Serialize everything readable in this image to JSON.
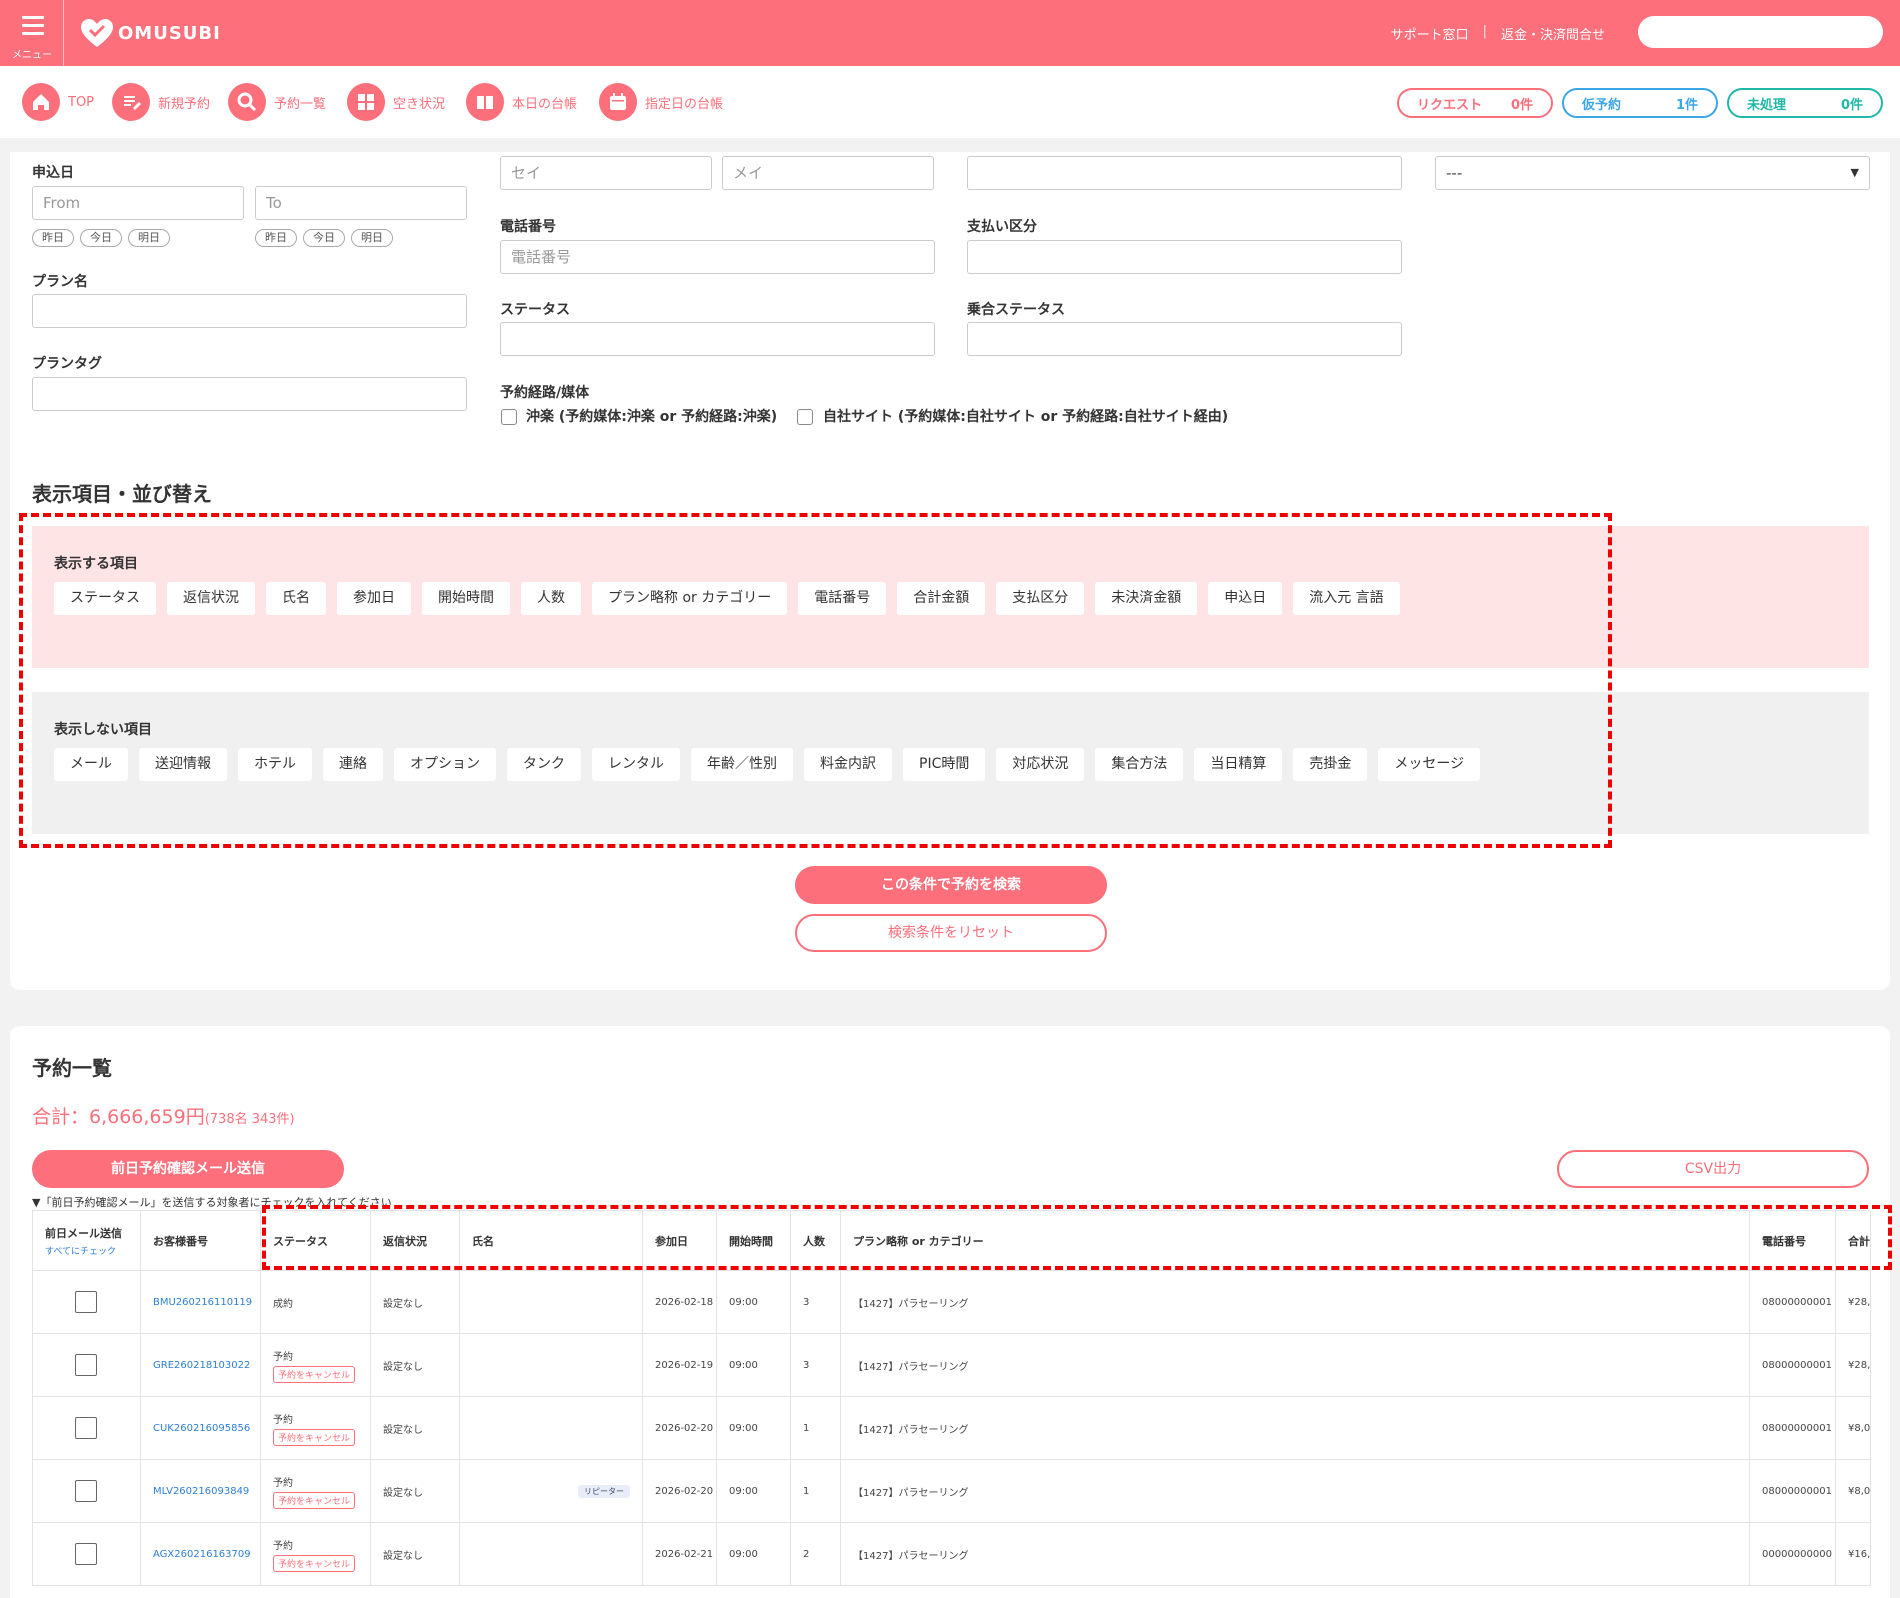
{
  "header": {
    "menu_label": "メニュー",
    "logo_text": "OMUSUBI",
    "links": [
      "サポート窓口",
      "|",
      "返金・決済問合せ"
    ],
    "accent": "#fc6f7b"
  },
  "nav": {
    "items": [
      {
        "label": "TOP",
        "icon": "home-icon"
      },
      {
        "label": "新規予約",
        "icon": "edit-icon"
      },
      {
        "label": "予約一覧",
        "icon": "search-icon"
      },
      {
        "label": "空き状況",
        "icon": "grid-icon"
      },
      {
        "label": "本日の台帳",
        "icon": "book-icon"
      },
      {
        "label": "指定日の台帳",
        "icon": "calendar-icon"
      }
    ],
    "pills": [
      {
        "label": "リクエスト",
        "count": "0件",
        "color": "#fc6f7b"
      },
      {
        "label": "仮予約",
        "count": "1件",
        "color": "#3ba6e8"
      },
      {
        "label": "未処理",
        "count": "0件",
        "color": "#1fb8a6"
      }
    ]
  },
  "search": {
    "application_date_label": "申込日",
    "from_placeholder": "From",
    "to_placeholder": "To",
    "quick_dates": [
      "昨日",
      "今日",
      "明日"
    ],
    "plan_name_label": "プラン名",
    "plan_tag_label": "プランタグ",
    "sei_placeholder": "セイ",
    "mei_placeholder": "メイ",
    "phone_label": "電話番号",
    "phone_placeholder": "電話番号",
    "payment_label": "支払い区分",
    "status_label": "ステータス",
    "boarding_status_label": "乗合ステータス",
    "route_label": "予約経路/媒体",
    "route_options": [
      "沖楽 (予約媒体:沖楽 or 予約経路:沖楽)",
      "自社サイト (予約媒体:自社サイト or 予約経路:自社サイト経由)"
    ],
    "select_value": "---"
  },
  "display": {
    "title": "表示項目・並び替え",
    "show_title": "表示する項目",
    "show_items": [
      "ステータス",
      "返信状況",
      "氏名",
      "参加日",
      "開始時間",
      "人数",
      "プラン略称 or カテゴリー",
      "電話番号",
      "合計金額",
      "支払区分",
      "未決済金額",
      "申込日",
      "流入元 言語"
    ],
    "hide_title": "表示しない項目",
    "hide_items": [
      "メール",
      "送迎情報",
      "ホテル",
      "連絡",
      "オプション",
      "タンク",
      "レンタル",
      "年齢／性別",
      "料金内訳",
      "PIC時間",
      "対応状況",
      "集合方法",
      "当日精算",
      "売掛金",
      "メッセージ"
    ],
    "search_button": "この条件で予約を検索",
    "reset_button": "検索条件をリセット"
  },
  "list": {
    "title": "予約一覧",
    "total": "合計：6,666,659円",
    "total_sub": "(738名 343件)",
    "mail_button": "前日予約確認メール送信",
    "csv_button": "CSV出力",
    "note": "▼「前日予約確認メール」を送信する対象者にチェックを入れてください",
    "headers": {
      "mail": "前日メール送信",
      "check_all": "すべてにチェック",
      "customer_no": "お客様番号",
      "status": "ステータス",
      "reply": "返信状況",
      "name": "氏名",
      "date": "参加日",
      "start": "開始時間",
      "people": "人数",
      "plan": "プラン略称 or カテゴリー",
      "phone": "電話番号",
      "total": "合計"
    },
    "rows": [
      {
        "id": "BMU260216110119",
        "status": "成約",
        "cancel": "",
        "reply": "設定なし",
        "badge": "",
        "date": "2026-02-18",
        "start": "09:00",
        "people": "3",
        "plan": "【1427】パラセーリング",
        "phone": "08000000001",
        "total": "¥28,"
      },
      {
        "id": "GRE260218103022",
        "status": "予約",
        "cancel": "予約をキャンセル",
        "reply": "設定なし",
        "badge": "",
        "date": "2026-02-19",
        "start": "09:00",
        "people": "3",
        "plan": "【1427】パラセーリング",
        "phone": "08000000001",
        "total": "¥28,"
      },
      {
        "id": "CUK260216095856",
        "status": "予約",
        "cancel": "予約をキャンセル",
        "reply": "設定なし",
        "badge": "",
        "date": "2026-02-20",
        "start": "09:00",
        "people": "1",
        "plan": "【1427】パラセーリング",
        "phone": "08000000001",
        "total": "¥8,0"
      },
      {
        "id": "MLV260216093849",
        "status": "予約",
        "cancel": "予約をキャンセル",
        "reply": "設定なし",
        "badge": "リピーター",
        "date": "2026-02-20",
        "start": "09:00",
        "people": "1",
        "plan": "【1427】パラセーリング",
        "phone": "08000000001",
        "total": "¥8,0"
      },
      {
        "id": "AGX260216163709",
        "status": "予約",
        "cancel": "予約をキャンセル",
        "reply": "設定なし",
        "badge": "",
        "date": "2026-02-21",
        "start": "09:00",
        "people": "2",
        "plan": "【1427】パラセーリング",
        "phone": "00000000000",
        "total": "¥16,"
      }
    ]
  }
}
